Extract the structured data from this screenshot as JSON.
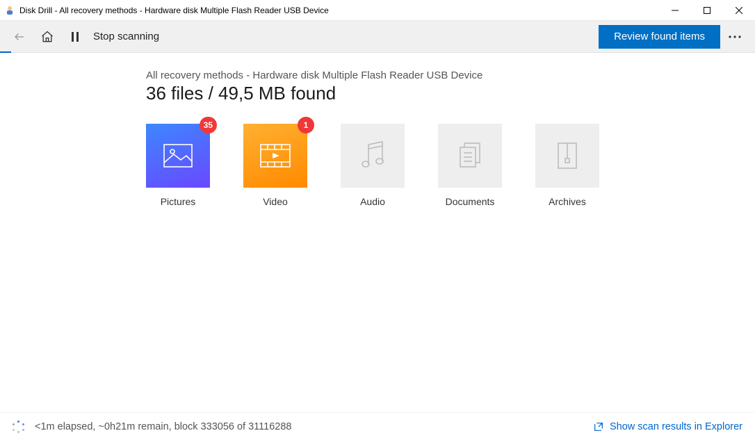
{
  "window": {
    "title": "Disk Drill - All recovery methods - Hardware disk Multiple Flash Reader USB Device"
  },
  "toolbar": {
    "stop_label": "Stop scanning",
    "review_label": "Review found items"
  },
  "main": {
    "breadcrumb": "All recovery methods - Hardware disk Multiple Flash Reader USB Device",
    "headline": "36 files / 49,5 MB found"
  },
  "categories": [
    {
      "key": "pictures",
      "label": "Pictures",
      "count": "35",
      "active": true
    },
    {
      "key": "video",
      "label": "Video",
      "count": "1",
      "active": true
    },
    {
      "key": "audio",
      "label": "Audio",
      "count": null,
      "active": false
    },
    {
      "key": "documents",
      "label": "Documents",
      "count": null,
      "active": false
    },
    {
      "key": "archives",
      "label": "Archives",
      "count": null,
      "active": false
    }
  ],
  "status": {
    "text": "<1m elapsed, ~0h21m remain, block 333056 of 31116288",
    "explorer_link": "Show scan results in Explorer"
  }
}
